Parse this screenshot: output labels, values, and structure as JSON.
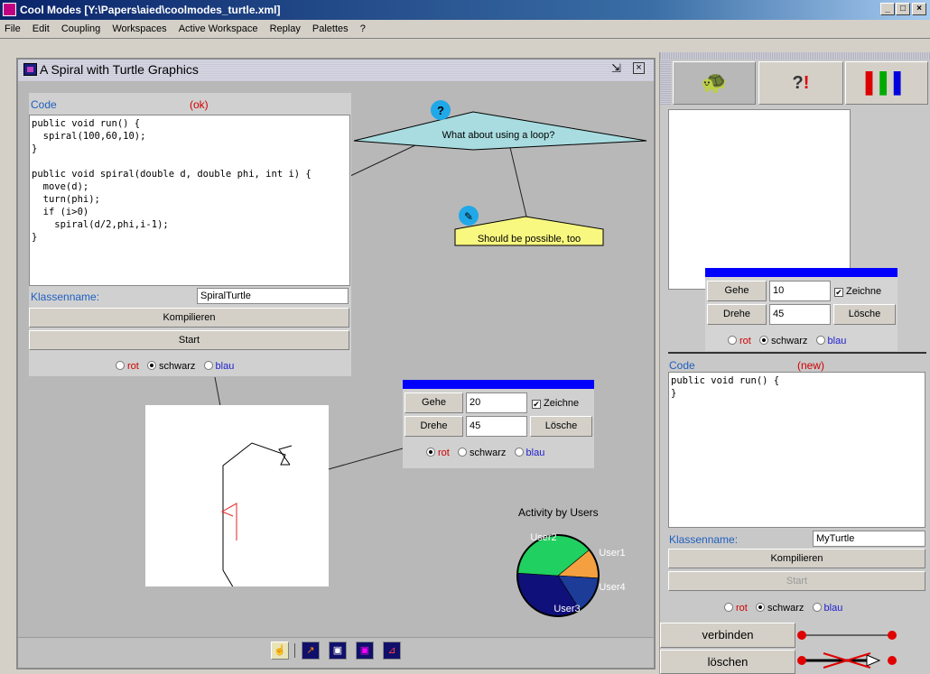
{
  "window": {
    "title": "Cool Modes [Y:\\Papers\\aied\\coolmodes_turtle.xml]",
    "btn_min": "_",
    "btn_max": "□",
    "btn_close": "×"
  },
  "menu": [
    "File",
    "Edit",
    "Coupling",
    "Workspaces",
    "Active Workspace",
    "Replay",
    "Palettes",
    "?"
  ],
  "workspace": {
    "title": "A Spiral with Turtle Graphics"
  },
  "code_panel": {
    "code_label": "Code",
    "status": "(ok)",
    "code": "public void run() {\n  spiral(100,60,10);\n}\n\npublic void spiral(double d, double phi, int i) {\n  move(d);\n  turn(phi);\n  if (i>0)\n    spiral(d/2,phi,i-1);\n}",
    "class_label": "Klassenname:",
    "class_value": "SpiralTurtle",
    "compile": "Kompilieren",
    "start": "Start",
    "colors": [
      "rot",
      "schwarz",
      "blau"
    ],
    "selected_color": "schwarz"
  },
  "note_question": "What about using a loop?",
  "note_pin": "Should be possible, too",
  "turtle_control": {
    "go": "Gehe",
    "go_value": "20",
    "draw": "Zeichne",
    "turn": "Drehe",
    "turn_value": "45",
    "clear": "Lösche",
    "colors": [
      "rot",
      "schwarz",
      "blau"
    ],
    "selected_color": "rot"
  },
  "activity": {
    "title": "Activity by Users",
    "users": [
      "User1",
      "User2",
      "User3",
      "User4"
    ],
    "shares": [
      0.12,
      0.38,
      0.35,
      0.15
    ],
    "colors": [
      "#f4a040",
      "#20d060",
      "#10107a",
      "#1c3c98"
    ]
  },
  "right_panel": {
    "control": {
      "go": "Gehe",
      "go_value": "10",
      "draw": "Zeichne",
      "turn": "Drehe",
      "turn_value": "45",
      "clear": "Lösche",
      "colors": [
        "rot",
        "schwarz",
        "blau"
      ],
      "selected_color": "schwarz"
    },
    "code_label": "Code",
    "status": "(new)",
    "code": "public void run() {\n}",
    "class_label": "Klassenname:",
    "class_value": "MyTurtle",
    "compile": "Kompilieren",
    "start": "Start",
    "colors": [
      "rot",
      "schwarz",
      "blau"
    ],
    "selected_color": "schwarz",
    "connect": "verbinden",
    "delete": "löschen"
  }
}
